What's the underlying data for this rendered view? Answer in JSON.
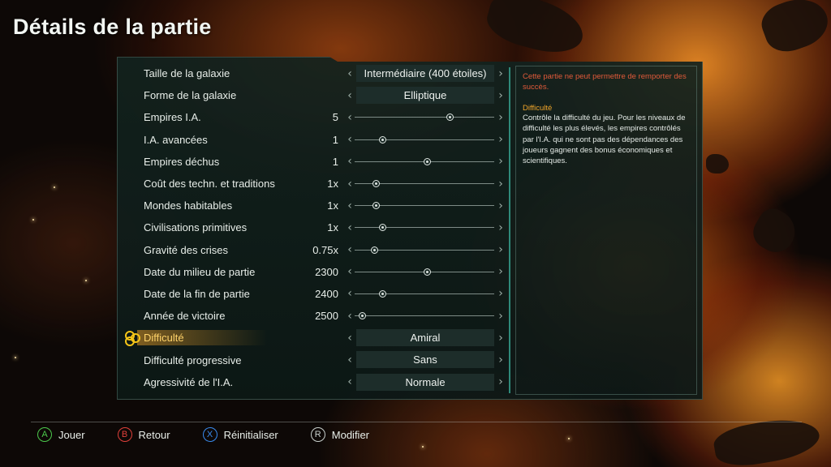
{
  "title": "Détails de la partie",
  "settings": [
    {
      "label": "Taille de la galaxie",
      "kind": "select",
      "value": "Intermédiaire (400 étoiles)"
    },
    {
      "label": "Forme de la galaxie",
      "kind": "select",
      "value": "Elliptique"
    },
    {
      "label": "Empires I.A.",
      "kind": "slider",
      "value": "5",
      "level": 0.68
    },
    {
      "label": "I.A. avancées",
      "kind": "slider",
      "value": "1",
      "level": 0.2
    },
    {
      "label": "Empires déchus",
      "kind": "slider",
      "value": "1",
      "level": 0.52
    },
    {
      "label": "Coût des techn. et traditions",
      "kind": "slider",
      "value": "1x",
      "level": 0.15
    },
    {
      "label": "Mondes habitables",
      "kind": "slider",
      "value": "1x",
      "level": 0.15
    },
    {
      "label": "Civilisations primitives",
      "kind": "slider",
      "value": "1x",
      "level": 0.2
    },
    {
      "label": "Gravité des crises",
      "kind": "slider",
      "value": "0.75x",
      "level": 0.14
    },
    {
      "label": "Date du milieu de partie",
      "kind": "slider",
      "value": "2300",
      "level": 0.52
    },
    {
      "label": "Date de la fin de partie",
      "kind": "slider",
      "value": "2400",
      "level": 0.2
    },
    {
      "label": "Année de victoire",
      "kind": "slider",
      "value": "2500",
      "level": 0.05
    },
    {
      "label": "Difficulté",
      "kind": "select",
      "value": "Amiral",
      "active": true
    },
    {
      "label": "Difficulté progressive",
      "kind": "select",
      "value": "Sans"
    },
    {
      "label": "Agressivité de l'I.A.",
      "kind": "select",
      "value": "Normale"
    }
  ],
  "info": {
    "warning": "Cette partie ne peut permettre de remporter des succès.",
    "title": "Difficulté",
    "text": "Contrôle la difficulté du jeu. Pour les niveaux de difficulté les plus élevés, les empires contrôlés par l'I.A. qui ne sont pas des dépendances des joueurs gagnent des bonus économiques et scientifiques."
  },
  "footer": [
    {
      "key": "A",
      "label": "Jouer",
      "color": "#4cc94c",
      "icon": "a-button-icon"
    },
    {
      "key": "B",
      "label": "Retour",
      "color": "#e0403a",
      "icon": "b-button-icon"
    },
    {
      "key": "X",
      "label": "Réinitialiser",
      "color": "#3a8cf0",
      "icon": "x-button-icon"
    },
    {
      "key": "R",
      "label": "Modifier",
      "color": "#c8cfcc",
      "icon": "r-button-icon"
    }
  ],
  "colors": {
    "accent": "#f0a52a",
    "warning": "#e05a3a",
    "divider": "#2f8a7a"
  }
}
